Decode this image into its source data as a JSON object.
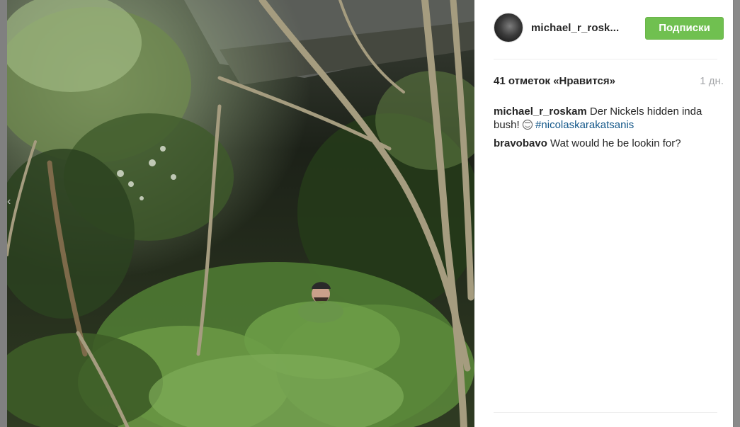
{
  "post": {
    "username": "michael_r_rosk...",
    "follow_label": "Подписки",
    "likes": "41 отметок «Нравится»",
    "age": "1 дн.",
    "colors": {
      "follow_button": "#70c050",
      "hashtag": "#125688",
      "text": "#262626",
      "muted": "#a5a7aa"
    }
  },
  "comments": [
    {
      "user": "michael_r_roskam",
      "text": "Der Nickels hidden inda bush!",
      "emoji": "grinning-face",
      "hashtag": "#nicolaskarakatsanis"
    },
    {
      "user": "bravobavo",
      "text": "Wat would he be lookin for?"
    }
  ],
  "navigation": {
    "prev_arrow": "‹"
  }
}
